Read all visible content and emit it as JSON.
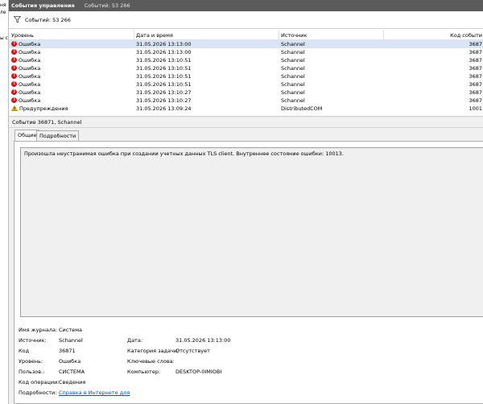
{
  "left_pane": {
    "fragments": [
      "ня",
      "ле",
      "ы с"
    ]
  },
  "titlebar": {
    "title": "События управления",
    "count": "Событий: 53 266"
  },
  "filterbar": {
    "count": "Событий: 53 266"
  },
  "grid": {
    "columns": [
      "Уровень",
      "Дата и время",
      "Источник",
      "Код событи"
    ],
    "rows": [
      {
        "level": "Ошибка",
        "type": "error",
        "date": "31.05.2026 13:13:00",
        "source": "Schannel",
        "code": "3687"
      },
      {
        "level": "Ошибка",
        "type": "error",
        "date": "31.05.2026 13:13:00",
        "source": "Schannel",
        "code": "3687"
      },
      {
        "level": "Ошибка",
        "type": "error",
        "date": "31.05.2026 13:10:51",
        "source": "Schannel",
        "code": "3687"
      },
      {
        "level": "Ошибка",
        "type": "error",
        "date": "31.05.2026 13:10:51",
        "source": "Schannel",
        "code": "3687"
      },
      {
        "level": "Ошибка",
        "type": "error",
        "date": "31.05.2026 13:10:51",
        "source": "Schannel",
        "code": "3687"
      },
      {
        "level": "Ошибка",
        "type": "error",
        "date": "31.05.2026 13:10:51",
        "source": "Schannel",
        "code": "3687"
      },
      {
        "level": "Ошибка",
        "type": "error",
        "date": "31.05.2026 13:10:27",
        "source": "Schannel",
        "code": "3687"
      },
      {
        "level": "Ошибка",
        "type": "error",
        "date": "31.05.2026 13:10:27",
        "source": "Schannel",
        "code": "3687"
      },
      {
        "level": "Предупреждения",
        "type": "warning",
        "date": "31.05.2026 13:09:24",
        "source": "DistributedCOM",
        "code": "1001"
      }
    ]
  },
  "detail": {
    "header": "Событие 36871, Schannel",
    "tabs": [
      "Общие",
      "Подробности"
    ],
    "message": "Произошла неустранимая ошибка при создании учетных данных TLS client. Внутреннее состояние ошибки: 10013.",
    "props": {
      "log_name_label": "Имя журнала:",
      "log_name": "Система",
      "source_label": "Источник:",
      "source": "Schannel",
      "date_label": "Дата:",
      "date": "31.05.2026 13:13:00",
      "code_label": "Код",
      "code": "36871",
      "task_label": "Категория задачи:",
      "task": "Отсутствует",
      "level_label": "Уровень:",
      "level": "Ошибка",
      "keywords_label": "Ключевые слова:",
      "keywords": "",
      "user_label": "Пользов.:",
      "user": "СИСТЕМА",
      "computer_label": "Компьютер:",
      "computer": "DESKTOP-0IMIOBI",
      "opcode_label": "Код операции:",
      "opcode": "Сведения",
      "more_label": "Подробности:",
      "more_link": "Справка в Интернете для"
    }
  }
}
